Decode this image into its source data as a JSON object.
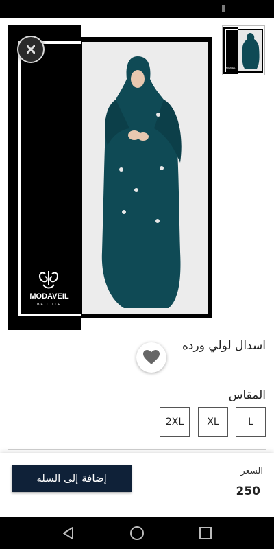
{
  "product": {
    "title": "اسدال لولي ورده",
    "brand_logo_text": "MODAVEIL",
    "brand_logo_subtext": "BE CUTE"
  },
  "sizes": {
    "label": "المقاس",
    "options": [
      "L",
      "XL",
      "2XL"
    ]
  },
  "purchase": {
    "price_label": "السعر",
    "price_value": "250",
    "add_to_cart_label": "إضافة إلى السله"
  },
  "colors": {
    "garment": "#0f4a55",
    "cart_button": "#0f2138",
    "frame": "#000000"
  },
  "icons": {
    "close": "close-icon",
    "wishlist": "heart-icon",
    "nav_back": "back-triangle-icon",
    "nav_home": "home-circle-icon",
    "nav_recents": "recents-square-icon"
  }
}
